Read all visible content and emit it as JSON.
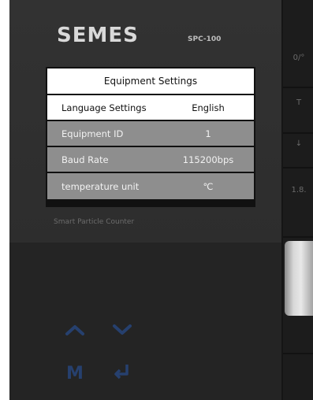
{
  "device": {
    "brand": "SEMES",
    "model": "SPC-100",
    "tagline": "Smart Particle Counter"
  },
  "settings_menu": {
    "title": "Equipment Settings",
    "items": [
      {
        "label": "Language Settings",
        "value": "English",
        "selected": true
      },
      {
        "label": "Equipment ID",
        "value": "1",
        "selected": false
      },
      {
        "label": "Baud Rate",
        "value": "115200bps",
        "selected": false
      },
      {
        "label": "temperature unit",
        "value": "℃",
        "selected": false
      }
    ]
  },
  "keypad": {
    "up_icon": "chevron-up-icon",
    "down_icon": "chevron-down-icon",
    "menu_label": "M",
    "enter_icon": "enter-icon"
  },
  "side_strip": {
    "labels": [
      "0/°",
      "T",
      "↓",
      "1.8."
    ]
  },
  "colors": {
    "panel": "#2c2c2c",
    "selected_row": "#ffffff",
    "unselected_row": "#8e8e8e",
    "keypad_blue": "#26406e"
  }
}
